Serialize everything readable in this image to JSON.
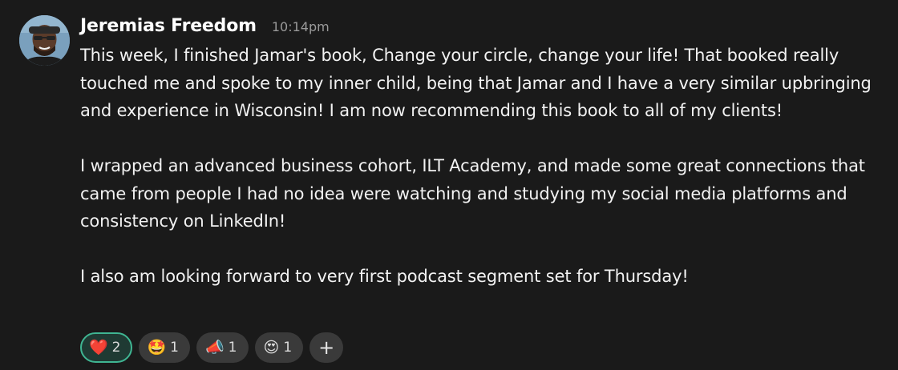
{
  "message": {
    "author": "Jeremias Freedom",
    "timestamp": "10:14pm",
    "paragraphs": [
      "This week, I finished Jamar's book, Change your circle, change your life! That booked really touched me and spoke to my inner child, being that Jamar and I have a very similar upbringing and experience in Wisconsin! I am now recommending this book to all of my clients!",
      "I wrapped an advanced business cohort, ILT Academy, and made some great connections that came from people I had no idea were watching and studying my social media platforms and consistency on LinkedIn!",
      "I also am looking forward to very first podcast segment set for Thursday!"
    ]
  },
  "reactions": [
    {
      "emoji": "❤️",
      "icon": "heart-icon",
      "count": "2",
      "active": true
    },
    {
      "emoji": "🤩",
      "icon": "star-struck-icon",
      "count": "1",
      "active": false
    },
    {
      "emoji": "📣",
      "icon": "megaphone-icon",
      "count": "1",
      "active": false
    },
    {
      "emoji": "😍",
      "icon": "heart-eyes-icon",
      "count": "1",
      "active": false
    }
  ],
  "add_reaction": {
    "label": "+",
    "icon": "plus-icon"
  },
  "colors": {
    "background": "#1a1a1a",
    "active_reaction_border": "#3fb592",
    "reaction_background": "#3a3a3a"
  }
}
